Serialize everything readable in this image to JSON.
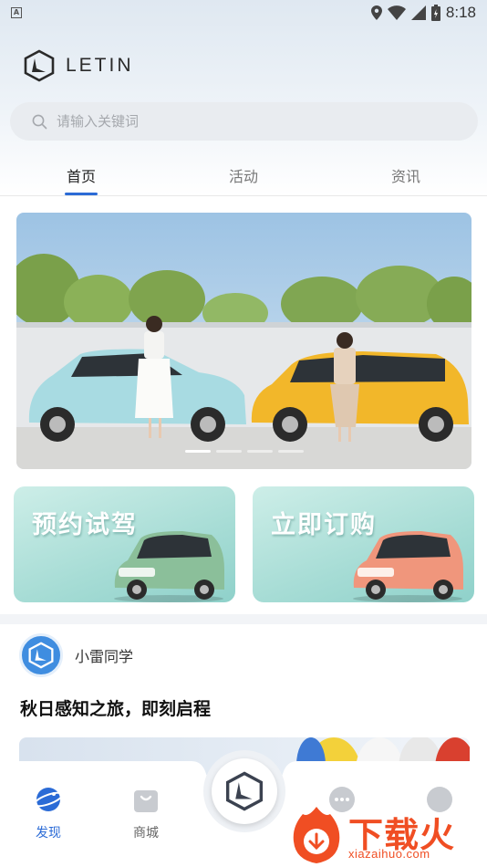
{
  "status_bar": {
    "time": "8:18",
    "notification_letter": "A"
  },
  "brand": {
    "name": "LETIN"
  },
  "search": {
    "placeholder": "请输入关键词"
  },
  "tabs": [
    {
      "label": "首页",
      "active": true
    },
    {
      "label": "活动",
      "active": false
    },
    {
      "label": "资讯",
      "active": false
    }
  ],
  "banner": {
    "page_count": 4,
    "current_page": 1
  },
  "promos": [
    {
      "label": "预约试驾",
      "car_color": "#8bbf9a"
    },
    {
      "label": "立即订购",
      "car_color": "#f0967c"
    }
  ],
  "post": {
    "author": "小雷同学",
    "title": "秋日感知之旅，即刻启程"
  },
  "bottom_nav": [
    {
      "label": "发现",
      "icon": "planet-icon",
      "active": true
    },
    {
      "label": "商城",
      "icon": "shopping-bag-icon",
      "active": false
    },
    {
      "label": "",
      "icon": "chat-icon",
      "active": false
    },
    {
      "label": "",
      "icon": "profile-icon",
      "active": false
    }
  ],
  "watermark": {
    "text": "下载火",
    "url": "xiazaihuo.com"
  },
  "colors": {
    "accent": "#2b6bd6",
    "promo_bg": "#a6dcd5",
    "watermark": "#f04e23"
  }
}
